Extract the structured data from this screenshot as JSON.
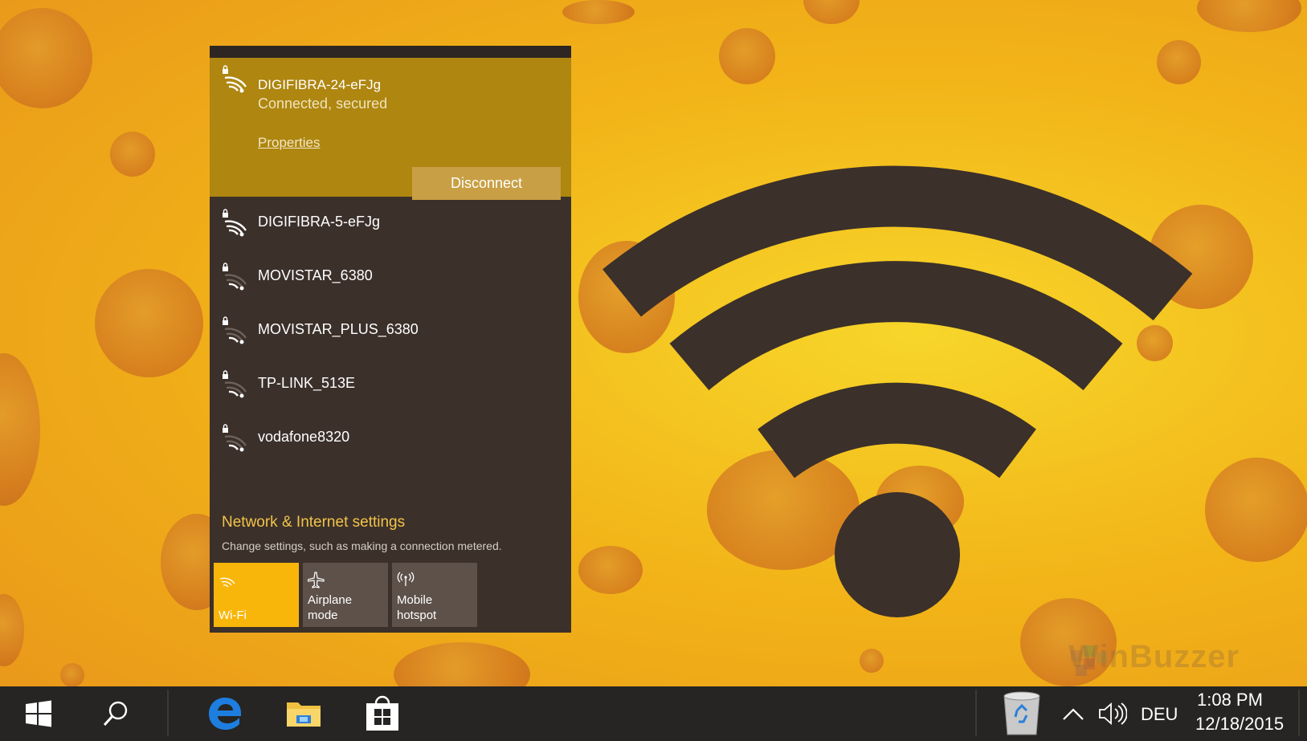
{
  "flyout": {
    "connected": {
      "ssid": "DIGIFIBRA-24-eFJg",
      "status": "Connected, secured",
      "properties_label": "Properties",
      "disconnect_label": "Disconnect"
    },
    "networks": [
      {
        "ssid": "DIGIFIBRA-5-eFJg",
        "signal": "strong"
      },
      {
        "ssid": "MOVISTAR_6380",
        "signal": "weak"
      },
      {
        "ssid": "MOVISTAR_PLUS_6380",
        "signal": "weak"
      },
      {
        "ssid": "TP-LINK_513E",
        "signal": "weak"
      },
      {
        "ssid": "vodafone8320",
        "signal": "weak"
      }
    ],
    "settings_link": "Network & Internet settings",
    "settings_desc": "Change settings, such as making a connection metered.",
    "tiles": {
      "wifi": "Wi-Fi",
      "airplane": "Airplane mode",
      "hotspot_line1": "Mobile",
      "hotspot_line2": "hotspot"
    }
  },
  "taskbar": {
    "language": "DEU",
    "time": "1:08 PM",
    "date": "12/18/2015"
  },
  "watermark": "WinBuzzer",
  "colors": {
    "accent": "#f9b60a",
    "connected_bg": "#ae8610",
    "flyout_bg": "#3b302a",
    "taskbar_bg": "#262523",
    "settings_link": "#f2c44a"
  },
  "icons": [
    "wifi-lock-icon",
    "airplane-icon",
    "hotspot-icon",
    "windows-logo-icon",
    "search-icon",
    "edge-icon",
    "file-explorer-icon",
    "store-icon",
    "recycle-bin-icon",
    "chevron-up-icon",
    "volume-icon"
  ]
}
